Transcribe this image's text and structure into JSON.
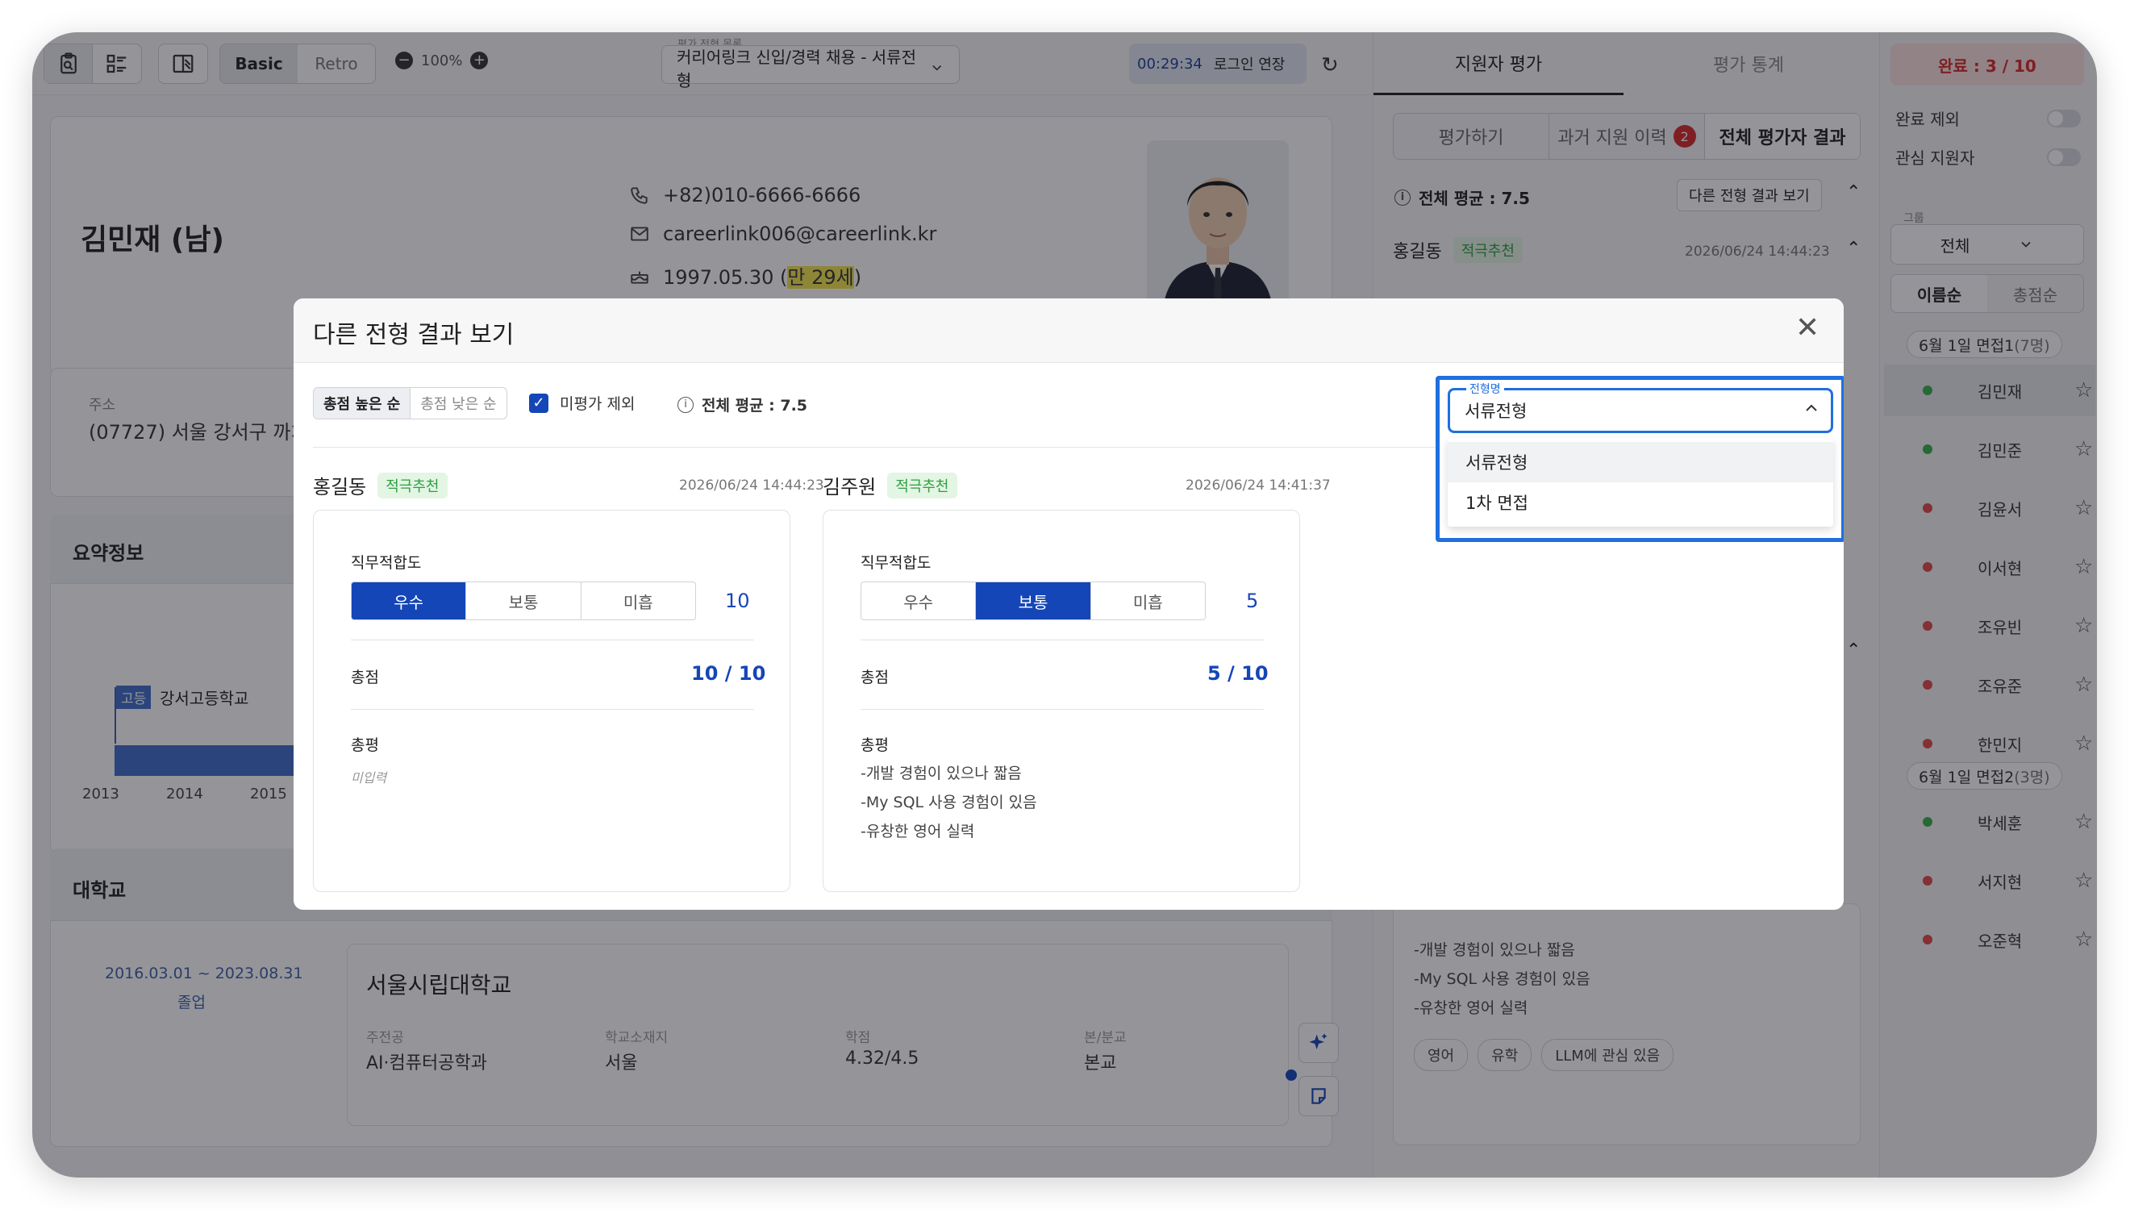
{
  "topbar": {
    "mode_basic": "Basic",
    "mode_retro": "Retro",
    "zoom": "100%",
    "eval_list_label": "평가 전형 목록",
    "eval_list_value": "커리어링크 신입/경력 채용 - 서류전형",
    "timer": "00:29:34",
    "extend_login": "로그인 연장"
  },
  "profile": {
    "name": "김민재 (남)",
    "phone": "+82)010-6666-6666",
    "email": "careerlink006@careerlink.kr",
    "birth_prefix": "1997.05.30 (",
    "age": "만 29세",
    "birth_suffix": ")",
    "address_label": "주소",
    "address": "(07727) 서울 강서구 까치"
  },
  "summary": {
    "title": "요약정보",
    "school_tag": "고등",
    "school_name": "강서고등학교",
    "years": [
      "2013",
      "2014",
      "2015"
    ]
  },
  "university": {
    "section_title": "대학교",
    "period": "2016.03.01 ~ 2023.08.31",
    "status": "졸업",
    "name": "서울시립대학교",
    "fields": [
      {
        "label": "주전공",
        "value": "AI·컴퓨터공학과"
      },
      {
        "label": "학교소재지",
        "value": "서울"
      },
      {
        "label": "학점",
        "value": "4.32/4.5"
      },
      {
        "label": "본/분교",
        "value": "본교"
      }
    ]
  },
  "right_panel": {
    "tabs": [
      "지원자 평가",
      "평가 통계"
    ],
    "subtabs": [
      "평가하기",
      "과거 지원 이력",
      "전체 평가자 결과"
    ],
    "history_count": "2",
    "avg": "전체 평균 : 7.5",
    "other_results_btn": "다른 전형 결과 보기",
    "evaluator": "홍길동",
    "evaluator_tag": "적극추천",
    "evaluator_date": "2026/06/24 14:44:23",
    "comments": [
      "-개발 경험이 있으나 짧음",
      "-My SQL 사용 경험이 있음",
      "-유창한 영어 실력"
    ],
    "chips": [
      "영어",
      "유학",
      "LLM에 관심 있음"
    ]
  },
  "list_panel": {
    "done": "완료 : 3 / 10",
    "exclude_done": "완료 제외",
    "interest": "관심 지원자",
    "group_label": "그룹",
    "group_value": "전체",
    "sort_name": "이름순",
    "sort_total": "총점순",
    "groups": [
      {
        "title": "6월 1일 면접1",
        "count": "(7명)",
        "candidates": [
          {
            "name": "김민재",
            "status": "green",
            "selected": true
          },
          {
            "name": "김민준",
            "status": "green",
            "selected": false
          },
          {
            "name": "김윤서",
            "status": "red",
            "selected": false
          },
          {
            "name": "이서현",
            "status": "red",
            "selected": false
          },
          {
            "name": "조유빈",
            "status": "red",
            "selected": false
          },
          {
            "name": "조유준",
            "status": "red",
            "selected": false
          },
          {
            "name": "한민지",
            "status": "red",
            "selected": false
          }
        ]
      },
      {
        "title": "6월 1일 면접2",
        "count": "(3명)",
        "candidates": [
          {
            "name": "박세훈",
            "status": "green",
            "selected": false
          },
          {
            "name": "서지현",
            "status": "red",
            "selected": false
          },
          {
            "name": "오준혁",
            "status": "red",
            "selected": false
          }
        ]
      }
    ]
  },
  "modal": {
    "title": "다른 전형 결과 보기",
    "sort_high": "총점 높은 순",
    "sort_low": "총점 낮은 순",
    "exclude_unrated": "미평가 제외",
    "avg": "전체 평균 : 7.5",
    "select_label": "전형명",
    "select_value": "서류전형",
    "options": [
      "서류전형",
      "1차 면접"
    ],
    "evaluations": [
      {
        "name": "홍길동",
        "tag": "적극추천",
        "date": "2026/06/24 14:44:23",
        "criterion": "직무적합도",
        "ratings": [
          "우수",
          "보통",
          "미흡"
        ],
        "selected": 0,
        "score": "10",
        "total_label": "총점",
        "total": "10 / 10",
        "comment_label": "총평",
        "comment_empty": "미입력",
        "comments": []
      },
      {
        "name": "김주원",
        "tag": "적극추천",
        "date": "2026/06/24 14:41:37",
        "criterion": "직무적합도",
        "ratings": [
          "우수",
          "보통",
          "미흡"
        ],
        "selected": 1,
        "score": "5",
        "total_label": "총점",
        "total": "5 / 10",
        "comment_label": "총평",
        "comment_empty": "",
        "comments": [
          "-개발 경험이 있으나 짧음",
          "-My SQL 사용 경험이 있음",
          "-유창한 영어 실력"
        ]
      }
    ]
  }
}
